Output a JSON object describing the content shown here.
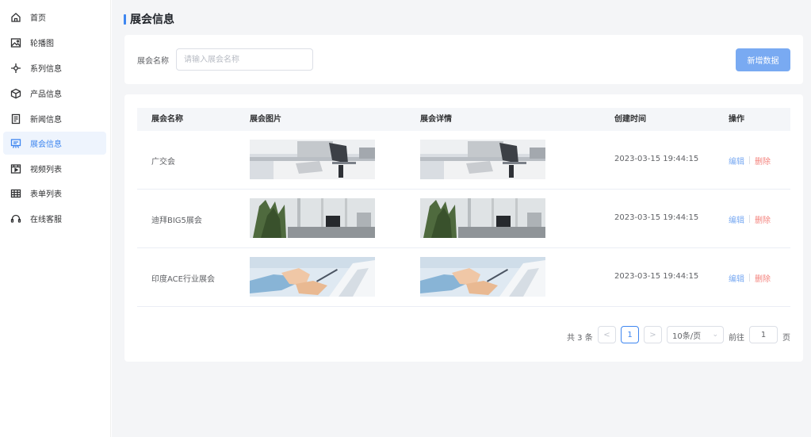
{
  "sidebar": {
    "items": [
      {
        "label": "首页",
        "icon": "home-icon"
      },
      {
        "label": "轮播图",
        "icon": "image-icon"
      },
      {
        "label": "系列信息",
        "icon": "series-icon"
      },
      {
        "label": "产品信息",
        "icon": "box-icon"
      },
      {
        "label": "新闻信息",
        "icon": "news-icon"
      },
      {
        "label": "展会信息",
        "icon": "exhibition-icon",
        "active": true
      },
      {
        "label": "视频列表",
        "icon": "video-icon"
      },
      {
        "label": "表单列表",
        "icon": "table-icon"
      },
      {
        "label": "在线客服",
        "icon": "headset-icon"
      }
    ]
  },
  "header": {
    "title": "展会信息"
  },
  "search": {
    "label": "展会名称",
    "placeholder": "请输入展会名称",
    "value": "",
    "add_button": "新增数据"
  },
  "table": {
    "columns": [
      "展会名称",
      "展会图片",
      "展会详情",
      "创建时间",
      "操作"
    ],
    "rows": [
      {
        "name": "广交会",
        "image": "office-desk-laptop",
        "detail_image": "office-desk-laptop",
        "created": "2023-03-15 19:44:15",
        "edit": "编辑",
        "delete": "删除"
      },
      {
        "name": "迪拜BIG5展会",
        "image": "office-plant-laptop",
        "detail_image": "office-plant-laptop",
        "created": "2023-03-15 19:44:15",
        "edit": "编辑",
        "delete": "删除"
      },
      {
        "name": "印度ACE行业展会",
        "image": "hands-writing",
        "detail_image": "hands-writing",
        "created": "2023-03-15 19:44:15",
        "edit": "编辑",
        "delete": "删除"
      }
    ]
  },
  "pagination": {
    "total_text": "共 3 条",
    "prev": "<",
    "current_page": "1",
    "next": ">",
    "page_size": "10条/页",
    "goto_label": "前往",
    "goto_value": "1",
    "page_unit": "页"
  },
  "colors": {
    "accent": "#3e86f0",
    "add_button": "#79aaf2",
    "delete": "#f4837d",
    "active_bg": "#eef4fd"
  }
}
